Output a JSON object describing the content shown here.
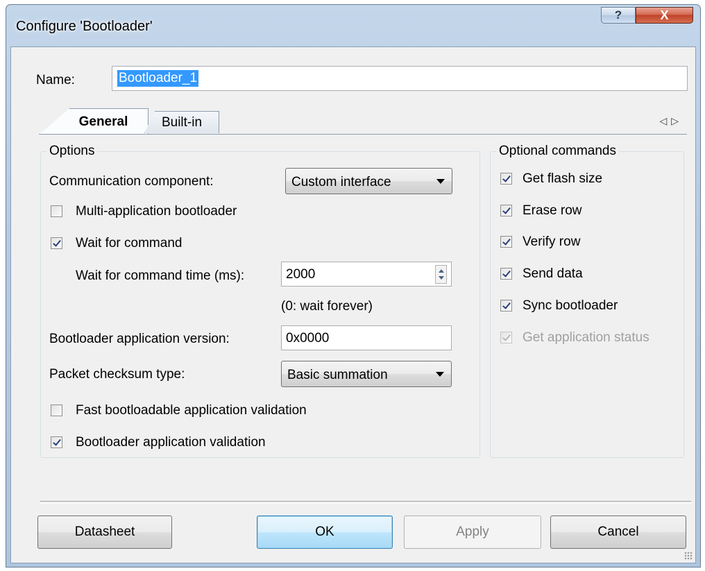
{
  "window": {
    "title": "Configure 'Bootloader'",
    "help_glyph": "?",
    "close_glyph": "X"
  },
  "name": {
    "label": "Name:",
    "value": "Bootloader_1"
  },
  "tabs": [
    {
      "label": "General",
      "selected": true
    },
    {
      "label": "Built-in",
      "selected": false
    }
  ],
  "tab_scroll": {
    "left": "◁",
    "right": "▷"
  },
  "options": {
    "title": "Options",
    "communication_component": {
      "label": "Communication component:",
      "value": "Custom interface"
    },
    "multi_application": {
      "label": "Multi-application bootloader",
      "checked": false
    },
    "wait_for_command": {
      "label": "Wait for command",
      "checked": true
    },
    "wait_time": {
      "label": "Wait for command time (ms):",
      "value": "2000",
      "hint": "(0: wait forever)"
    },
    "app_version": {
      "label": "Bootloader application version:",
      "value": "0x0000"
    },
    "checksum": {
      "label": "Packet checksum type:",
      "value": "Basic summation"
    },
    "fast_validation": {
      "label": "Fast bootloadable application validation",
      "checked": false
    },
    "app_validation": {
      "label": "Bootloader application validation",
      "checked": true
    }
  },
  "optional_commands": {
    "title": "Optional commands",
    "items": [
      {
        "label": "Get flash size",
        "checked": true,
        "enabled": true
      },
      {
        "label": "Erase row",
        "checked": true,
        "enabled": true
      },
      {
        "label": "Verify row",
        "checked": true,
        "enabled": true
      },
      {
        "label": "Send data",
        "checked": true,
        "enabled": true
      },
      {
        "label": "Sync bootloader",
        "checked": true,
        "enabled": true
      },
      {
        "label": "Get application status",
        "checked": true,
        "enabled": false
      }
    ]
  },
  "buttons": {
    "datasheet": "Datasheet",
    "ok": "OK",
    "apply": "Apply",
    "cancel": "Cancel"
  },
  "colors": {
    "titlebar": "#b6cbe2",
    "close_button": "#c0432a",
    "selection": "#3399ff",
    "dialog_bg": "#f0f0f0"
  }
}
